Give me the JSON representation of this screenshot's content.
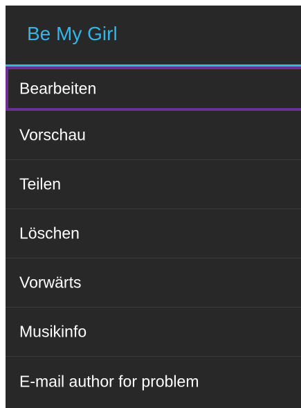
{
  "dialog": {
    "title": "Be My Girl",
    "accent_color": "#33b5e5",
    "focus_color": "#6a2e94",
    "background_color": "#282828"
  },
  "menu": {
    "items": [
      {
        "label": "Bearbeiten",
        "focused": true
      },
      {
        "label": "Vorschau",
        "focused": false
      },
      {
        "label": "Teilen",
        "focused": false
      },
      {
        "label": "Löschen",
        "focused": false
      },
      {
        "label": "Vorwärts",
        "focused": false
      },
      {
        "label": "Musikinfo",
        "focused": false
      },
      {
        "label": "E-mail author for problem",
        "focused": false
      }
    ]
  }
}
